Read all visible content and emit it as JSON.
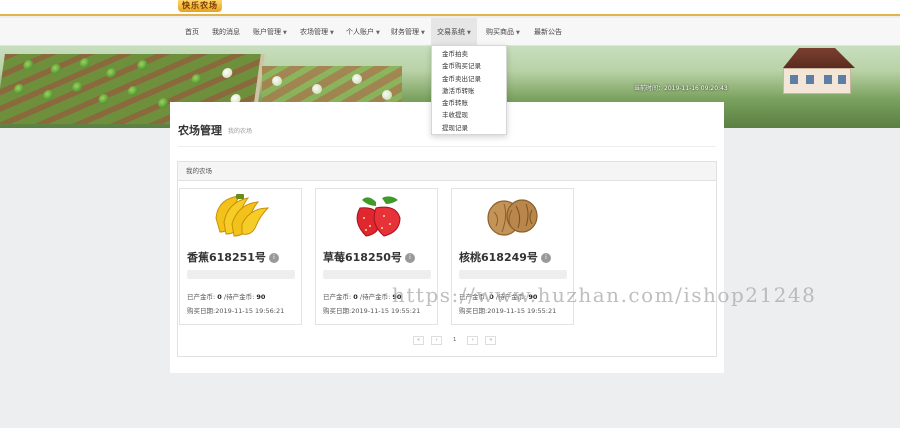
{
  "brand": {
    "logo_text": "快乐农场"
  },
  "nav": {
    "items": [
      {
        "label": "首页",
        "caret": false
      },
      {
        "label": "我的消息",
        "caret": false
      },
      {
        "label": "账户管理",
        "caret": true
      },
      {
        "label": "农场管理",
        "caret": true
      },
      {
        "label": "个人账户",
        "caret": true
      },
      {
        "label": "财务管理",
        "caret": true
      },
      {
        "label": "交易系统",
        "caret": true,
        "active": true
      },
      {
        "label": "购买商品",
        "caret": true
      },
      {
        "label": "最新公告",
        "caret": false
      }
    ],
    "caret_glyph": "▼"
  },
  "dropdown": {
    "items": [
      "金币拍卖",
      "金币购买记录",
      "金币卖出记录",
      "激活币转账",
      "金币转账",
      "丰收提现",
      "提现记录"
    ]
  },
  "banner": {
    "server_time": "当前时间：2019-11-16 09:20:43"
  },
  "page": {
    "title": "农场管理",
    "subtitle": "我的农场"
  },
  "farm_box": {
    "header": "我的农场"
  },
  "cards": [
    {
      "name": "香蕉618251号",
      "icon": "banana-icon",
      "produced_label": "已产金币:",
      "produced": "0",
      "pending_label": "/待产金币:",
      "pending": "90",
      "date_label": "购买日期:",
      "date": "2019-11-15 19:56:21"
    },
    {
      "name": "草莓618250号",
      "icon": "strawberry-icon",
      "produced_label": "已产金币:",
      "produced": "0",
      "pending_label": "/待产金币:",
      "pending": "90",
      "date_label": "购买日期:",
      "date": "2019-11-15 19:55:21"
    },
    {
      "name": "核桃618249号",
      "icon": "walnut-icon",
      "produced_label": "已产金币:",
      "produced": "0",
      "pending_label": "/待产金币:",
      "pending": "90",
      "date_label": "购买日期:",
      "date": "2019-11-15 19:55:21"
    }
  ],
  "info_badge": "i",
  "pagination": {
    "first": "«",
    "prev": "‹",
    "current": "1",
    "next": "›",
    "last": "»"
  },
  "watermark": "https://www.huzhan.com/ishop21248"
}
